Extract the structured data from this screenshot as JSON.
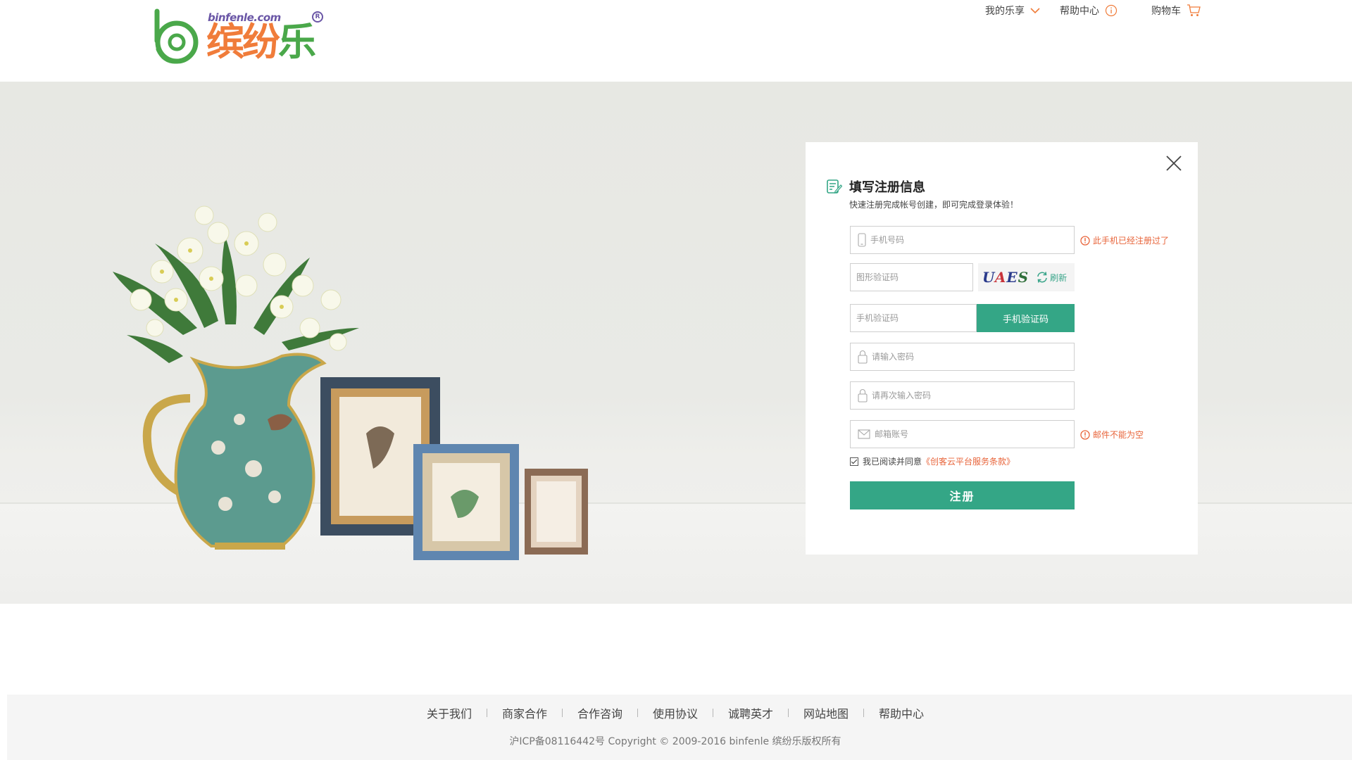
{
  "header": {
    "logo": {
      "domain": "binfenle.com",
      "brand": "缤纷乐",
      "reg_mark": "R"
    },
    "nav": {
      "my_le": "我的乐享",
      "help": "帮助中心",
      "cart": "购物车"
    }
  },
  "register": {
    "title": "填写注册信息",
    "subtitle": "快速注册完成帐号创建，即可完成登录体验！",
    "phone": {
      "placeholder": "手机号码",
      "value": "",
      "error": "此手机已经注册过了"
    },
    "captcha": {
      "placeholder": "图形验证码",
      "code": [
        "U",
        "A",
        "E",
        "S"
      ],
      "refresh_label": "刷新"
    },
    "sms": {
      "placeholder": "手机验证码",
      "button_label": "手机验证码"
    },
    "password": {
      "placeholder": "请输入密码"
    },
    "password_confirm": {
      "placeholder": "请再次输入密码"
    },
    "email": {
      "placeholder": "邮箱账号",
      "error": "邮件不能为空"
    },
    "agreement": {
      "prefix": "我已阅读并同意",
      "link": "《创客云平台服务条款》",
      "checked": true
    },
    "submit_label": "注册"
  },
  "footer": {
    "links": [
      "关于我们",
      "商家合作",
      "合作咨询",
      "使用协议",
      "诚聘英才",
      "网站地图",
      "帮助中心"
    ],
    "copyright": "沪ICP备08116442号 Copyright © 2009-2016 binfenle 缤纷乐版权所有"
  },
  "colors": {
    "accent": "#34a686",
    "error": "#e8643a",
    "brand_orange": "#f07c3a",
    "brand_green": "#4aa84a"
  }
}
